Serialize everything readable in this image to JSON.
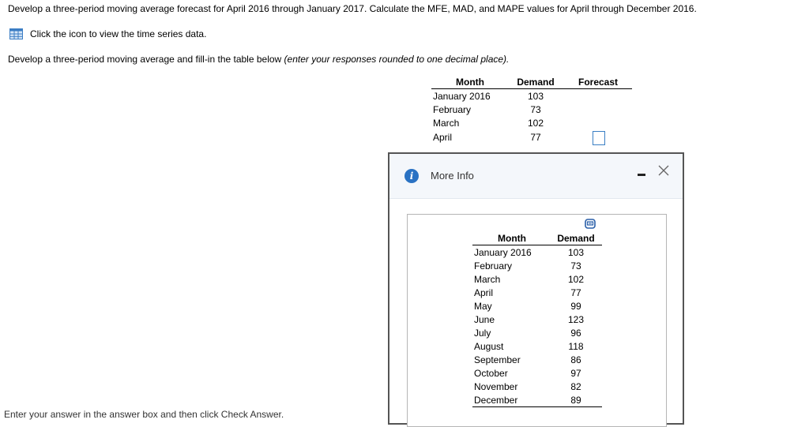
{
  "question": {
    "line1": "Develop a three-period moving average forecast for April 2016 through January 2017. Calculate the MFE, MAD, and MAPE values for April through December 2016.",
    "icon_link_text": "Click the icon to view the time series data.",
    "line3_main": "Develop a three-period moving average and fill-in the table below ",
    "line3_hint": "(enter your responses rounded to one decimal place)."
  },
  "main_table": {
    "headers": {
      "month": "Month",
      "demand": "Demand",
      "forecast": "Forecast"
    },
    "rows": [
      {
        "month": "January 2016",
        "demand": "103"
      },
      {
        "month": "February",
        "demand": "73"
      },
      {
        "month": "March",
        "demand": "102"
      },
      {
        "month": "April",
        "demand": "77",
        "forecast_input": ""
      }
    ]
  },
  "dialog": {
    "title": "More Info",
    "table": {
      "headers": {
        "month": "Month",
        "demand": "Demand"
      },
      "rows": [
        {
          "month": "January 2016",
          "demand": "103"
        },
        {
          "month": "February",
          "demand": "73"
        },
        {
          "month": "March",
          "demand": "102"
        },
        {
          "month": "April",
          "demand": "77"
        },
        {
          "month": "May",
          "demand": "99"
        },
        {
          "month": "June",
          "demand": "123"
        },
        {
          "month": "July",
          "demand": "96"
        },
        {
          "month": "August",
          "demand": "118"
        },
        {
          "month": "September",
          "demand": "86"
        },
        {
          "month": "October",
          "demand": "97"
        },
        {
          "month": "November",
          "demand": "82"
        },
        {
          "month": "December",
          "demand": "89"
        }
      ]
    }
  },
  "footer": {
    "text": "Enter your answer in the answer box and then click Check Answer."
  },
  "icons": {
    "data_table": "grid-table-icon",
    "info": "info-icon",
    "minimize": "minimize-icon",
    "close": "close-icon",
    "copy": "copy-icon"
  },
  "colors": {
    "accent": "#2a72c3",
    "answer_box_border": "#3a7fc4",
    "dialog_header_bg": "#f4f7fb"
  }
}
